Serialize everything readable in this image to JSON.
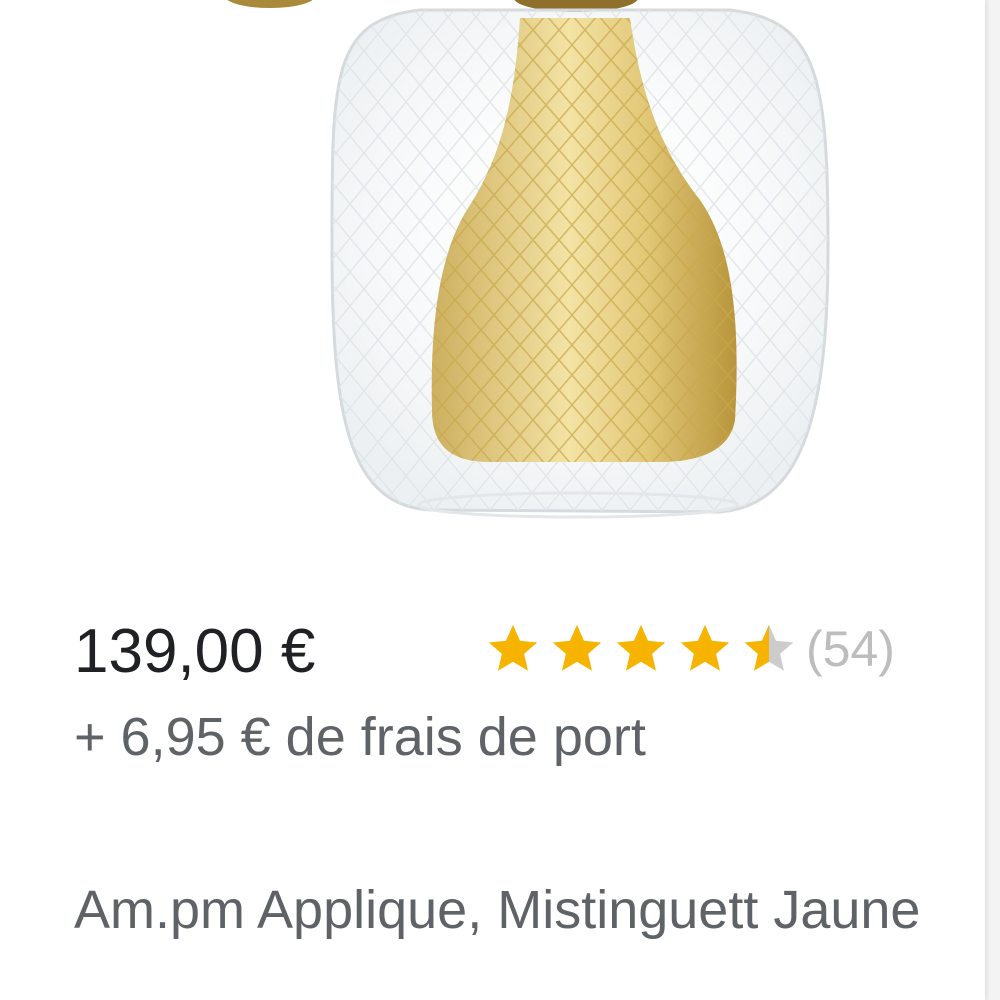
{
  "product": {
    "image_icon": "product-photo-lamp",
    "price": "139,00 €",
    "shipping": "+ 6,95 € de frais de port",
    "rating": {
      "value": 4.5,
      "max": 5,
      "count_label": "(54)",
      "star_color": "#f6b400",
      "empty_star_color": "#cccccc"
    },
    "title": "Am.pm Applique, Mistinguett Jaune"
  }
}
